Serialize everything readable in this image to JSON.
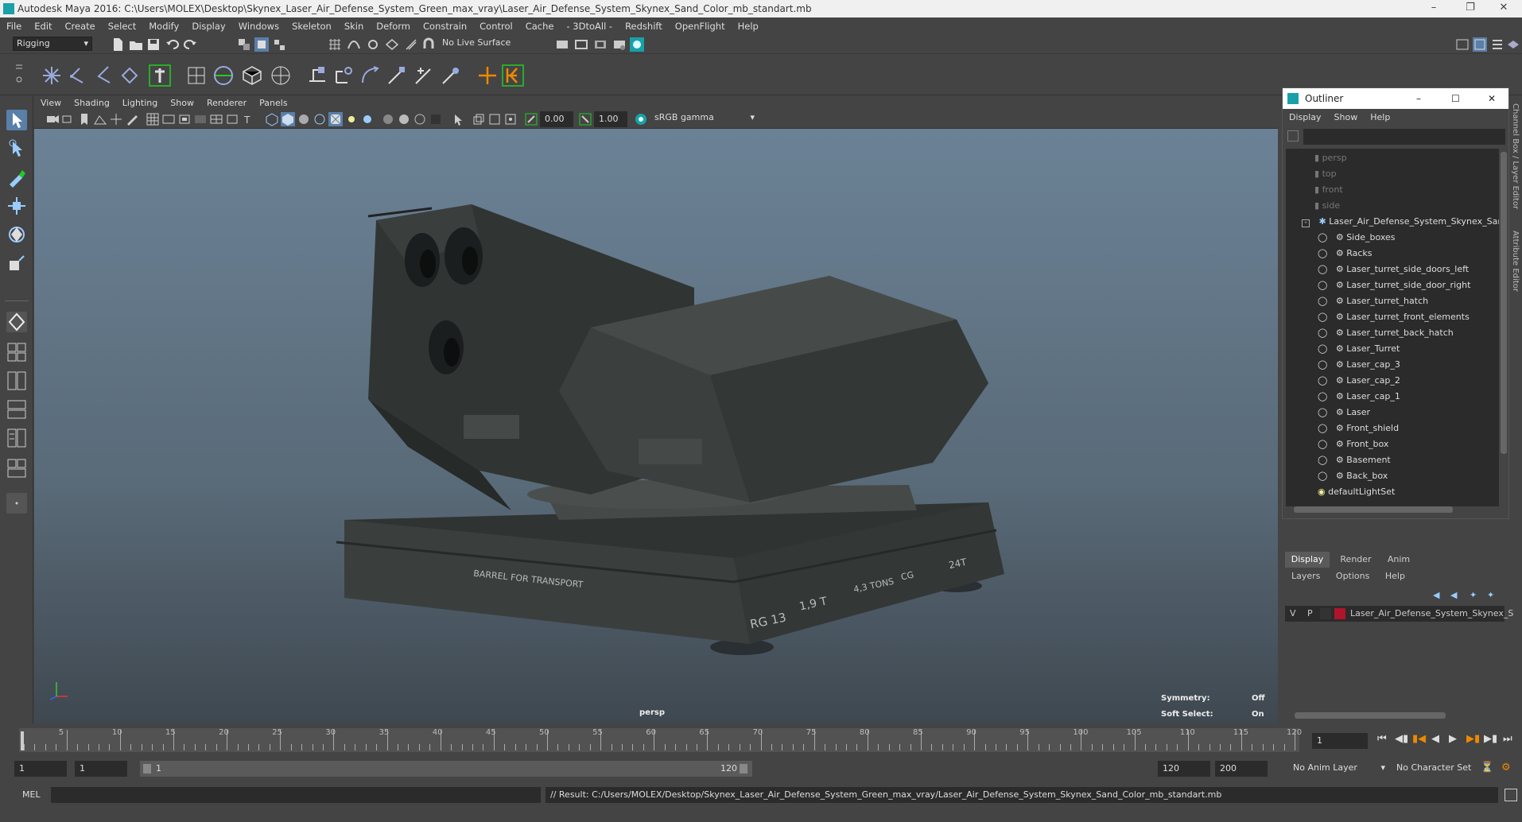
{
  "window": {
    "title": "Autodesk Maya 2016: C:\\Users\\MOLEX\\Desktop\\Skynex_Laser_Air_Defense_System_Green_max_vray\\Laser_Air_Defense_System_Skynex_Sand_Color_mb_standart.mb"
  },
  "menubar": [
    "File",
    "Edit",
    "Create",
    "Select",
    "Modify",
    "Display",
    "Windows",
    "Skeleton",
    "Skin",
    "Deform",
    "Constrain",
    "Control",
    "Cache",
    "- 3DtoAll -",
    "Redshift",
    "OpenFlight",
    "Help"
  ],
  "statusline": {
    "mode": "Rigging",
    "live_surface": "No Live Surface"
  },
  "viewport": {
    "menu": [
      "View",
      "Shading",
      "Lighting",
      "Show",
      "Renderer",
      "Panels"
    ],
    "exposure": "0.00",
    "gamma": "1.00",
    "color_space": "sRGB gamma",
    "camera_label": "persp",
    "hud": {
      "symmetry_label": "Symmetry:",
      "symmetry_value": "Off",
      "soft_select_label": "Soft Select:",
      "soft_select_value": "On"
    },
    "decals": {
      "barrel": "BARREL FOR TRANSPORT",
      "rg": "RG 13",
      "weight1": "1,9 T",
      "weight2": "4,3 TONS",
      "cg": "CG",
      "weight3": "24T"
    }
  },
  "outliner": {
    "title": "Outliner",
    "menu": [
      "Display",
      "Show",
      "Help"
    ],
    "cameras": [
      "persp",
      "top",
      "front",
      "side"
    ],
    "root": "Laser_Air_Defense_System_Skynex_Sand_",
    "children": [
      "Side_boxes",
      "Racks",
      "Laser_turret_side_doors_left",
      "Laser_turret_side_door_right",
      "Laser_turret_hatch",
      "Laser_turret_front_elements",
      "Laser_turret_back_hatch",
      "Laser_Turret",
      "Laser_cap_3",
      "Laser_cap_2",
      "Laser_cap_1",
      "Laser",
      "Front_shield",
      "Front_box",
      "Basement",
      "Back_box"
    ],
    "light_set": "defaultLightSet"
  },
  "side_tabs": [
    "Channel Box / Layer Editor",
    "Attribute Editor"
  ],
  "layer_editor": {
    "tabs": [
      "Display",
      "Render",
      "Anim"
    ],
    "menu": [
      "Layers",
      "Options",
      "Help"
    ],
    "layer": {
      "v": "V",
      "p": "P",
      "name": "Laser_Air_Defense_System_Skynex_S",
      "color": "#b0142c"
    }
  },
  "timeline": {
    "ticks": [
      5,
      10,
      15,
      20,
      25,
      30,
      35,
      40,
      45,
      50,
      55,
      60,
      65,
      70,
      75,
      80,
      85,
      90,
      95,
      100,
      105,
      110,
      115,
      120
    ],
    "current_frame": "1",
    "range_start": "1",
    "range_start2": "1",
    "slider_start": "1",
    "slider_end": "120",
    "end": "120",
    "max": "200",
    "anim_layer": "No Anim Layer",
    "char_set": "No Character Set"
  },
  "command": {
    "lang": "MEL",
    "result": "// Result: C:/Users/MOLEX/Desktop/Skynex_Laser_Air_Defense_System_Green_max_vray/Laser_Air_Defense_System_Skynex_Sand_Color_mb_standart.mb"
  }
}
